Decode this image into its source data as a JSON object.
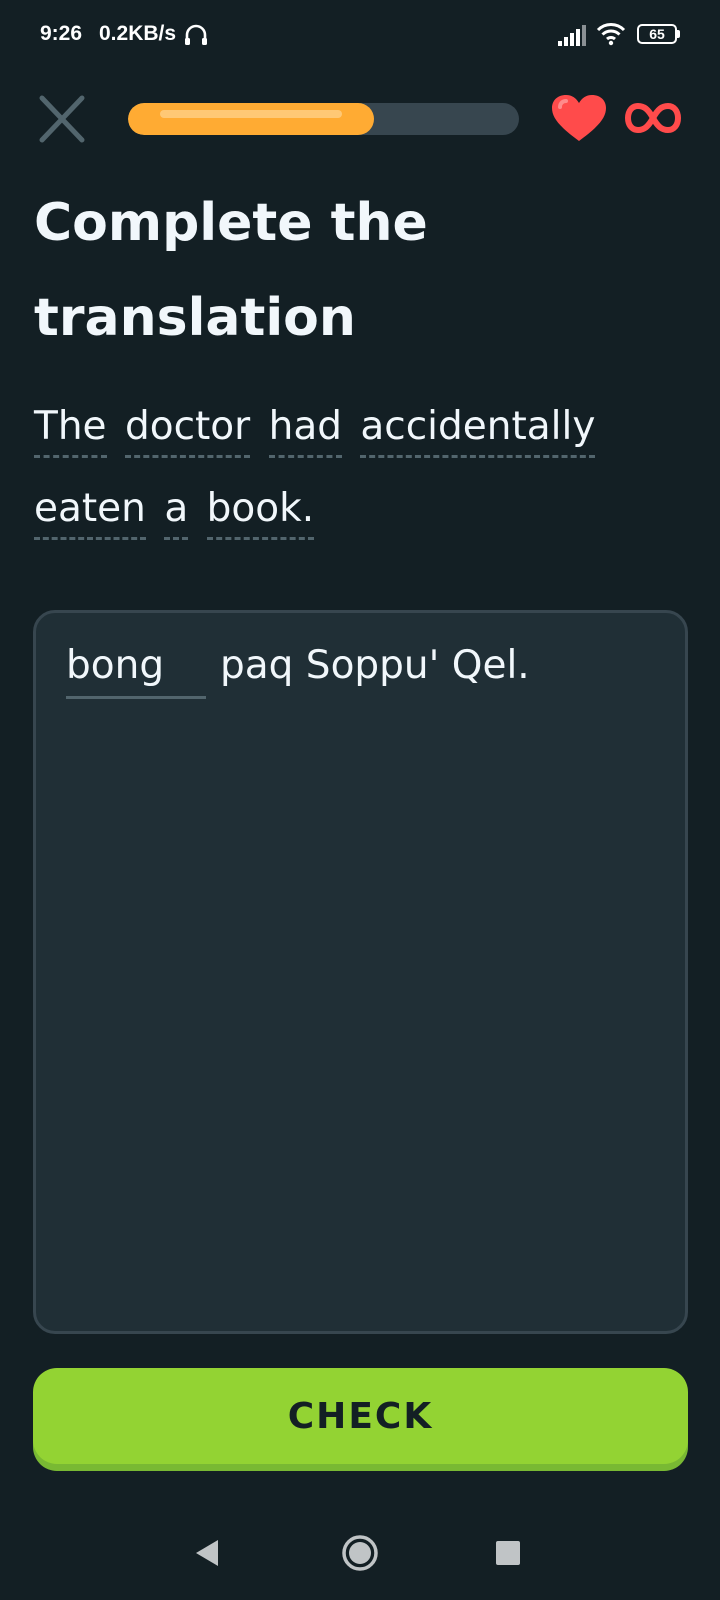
{
  "status_bar": {
    "time": "9:26",
    "network_speed": "0.2KB/s",
    "battery_level": "65",
    "icons": [
      "headset-icon",
      "signal-icon",
      "wifi-icon",
      "battery-icon"
    ]
  },
  "lesson": {
    "progress_fraction": 0.63,
    "hearts": "∞",
    "close_icon": "close-icon",
    "heart_icon": "heart-icon",
    "infinity_icon": "infinity-icon"
  },
  "exercise": {
    "title": "Complete the translation",
    "prompt_words": [
      "The",
      "doctor",
      "had",
      "accidentally",
      "eaten",
      "a",
      "book."
    ],
    "answer": {
      "filled_word": "bong",
      "remaining_text": "paq Soppu' Qel."
    }
  },
  "actions": {
    "check_label": "CHECK"
  },
  "navigation": {
    "icons": [
      "back-icon",
      "home-icon",
      "recents-icon"
    ]
  },
  "colors": {
    "background": "#131f24",
    "progress": "#ffab33",
    "check_button": "#93d333",
    "heart": "#ff4b4b"
  }
}
